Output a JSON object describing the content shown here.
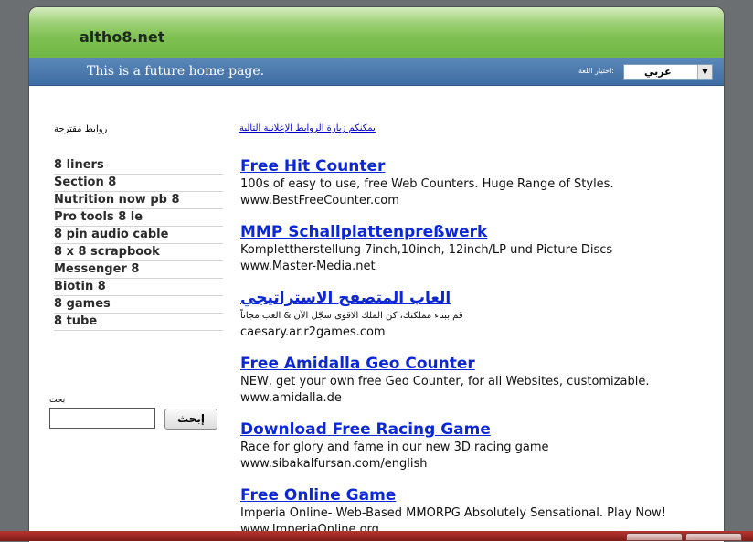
{
  "header": {
    "site_name": "altho8.net",
    "tagline": "This is a future home page.",
    "language_label": "اختيار اللغة:",
    "language_value": "عربي"
  },
  "sidebar": {
    "related_title": "روابط مقترحة",
    "links": [
      "8 liners",
      "Section 8",
      "Nutrition now pb 8",
      "Pro tools 8 le",
      "8 pin audio cable",
      "8 x 8 scrapbook",
      "Messenger 8",
      "Biotin 8",
      "8 games",
      "8 tube"
    ],
    "search_label": "بحث",
    "search_value": "",
    "search_button": "إبحث"
  },
  "main": {
    "intro": "يمكنكم زيارة الروابط الإعلانية التالية",
    "ads": [
      {
        "title": "Free Hit Counter",
        "desc": "100s of easy to use, free Web Counters. Huge Range of Styles.",
        "url": "www.BestFreeCounter.com"
      },
      {
        "title": "MMP Schallplattenpreßwerk",
        "desc": "Komplettherstellung 7inch,10inch, 12inch/LP und Picture Discs",
        "url": "www.Master-Media.net"
      },
      {
        "title": "العاب المتصفح الاستراتيجي",
        "desc": "قم ببناء مملكتك، كن الملك الاقوى سجّل الآن & العب مجاناً",
        "url": "caesary.ar.r2games.com"
      },
      {
        "title": "Free Amidalla Geo Counter",
        "desc": "NEW, get your own free Geo Counter, for all Websites, customizable.",
        "url": "www.amidalla.de"
      },
      {
        "title": "Download Free Racing Game",
        "desc": "Race for glory and fame in our new 3D racing game",
        "url": "www.sibakalfursan.com/english"
      },
      {
        "title": "Free Online Game",
        "desc": "Imperia Online- Web-Based MMORPG Absolutely Sensational. Play Now!",
        "url": "www.ImperiaOnline.org"
      }
    ]
  },
  "colors": {
    "header_green": "#7ec052",
    "header_blue": "#3e6da4",
    "link_blue": "#0b27d6",
    "taskbar_red": "#9e2a25",
    "page_bg": "#6b6f72"
  }
}
